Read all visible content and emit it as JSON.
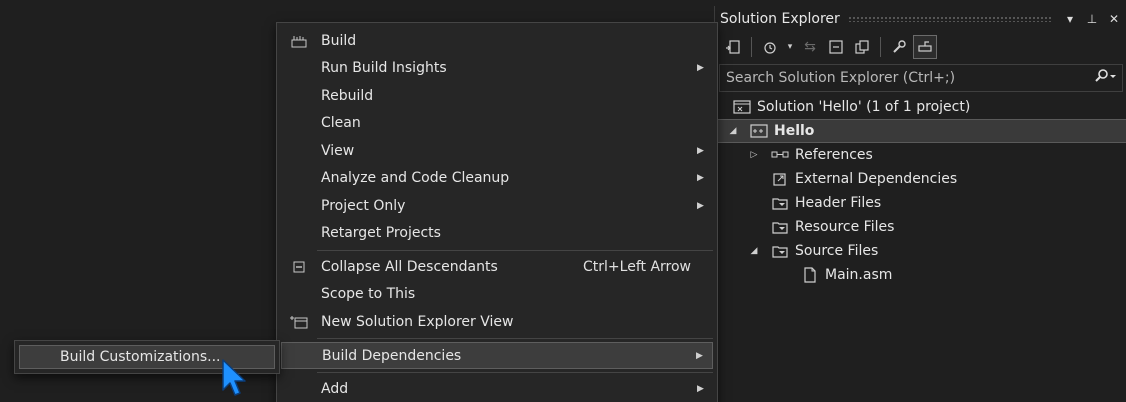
{
  "solution_explorer": {
    "title": "Solution Explorer",
    "title_buttons": [
      "▾",
      "⊥",
      "✕"
    ],
    "search_placeholder": "Search Solution Explorer (Ctrl+;)",
    "search_icon": "search-icon",
    "tree": {
      "solution": "Solution 'Hello' (1 of 1 project)",
      "project": "Hello",
      "references": "References",
      "external_dependencies": "External Dependencies",
      "header_files": "Header Files",
      "resource_files": "Resource Files",
      "source_files": "Source Files",
      "main_file": "Main.asm"
    }
  },
  "context_menu": {
    "items": [
      {
        "label": "Build",
        "icon": "build-icon"
      },
      {
        "label": "Run Build Insights",
        "submenu": true
      },
      {
        "label": "Rebuild"
      },
      {
        "label": "Clean"
      },
      {
        "label": "View",
        "submenu": true
      },
      {
        "label": "Analyze and Code Cleanup",
        "submenu": true
      },
      {
        "label": "Project Only",
        "submenu": true
      },
      {
        "label": "Retarget Projects"
      },
      {
        "label": "Collapse All Descendants",
        "shortcut": "Ctrl+Left Arrow",
        "icon": "collapse-icon"
      },
      {
        "label": "Scope to This"
      },
      {
        "label": "New Solution Explorer View",
        "icon": "new-view-icon"
      },
      {
        "label": "Build Dependencies",
        "submenu": true,
        "highlighted": true
      },
      {
        "label": "Add",
        "submenu": true
      }
    ]
  },
  "submenu": {
    "item": "Build Customizations..."
  },
  "colors": {
    "background": "#1f1f1f",
    "menu_bg": "#262626",
    "highlight": "#3d3d3d",
    "cursor": "#1e90ff"
  }
}
